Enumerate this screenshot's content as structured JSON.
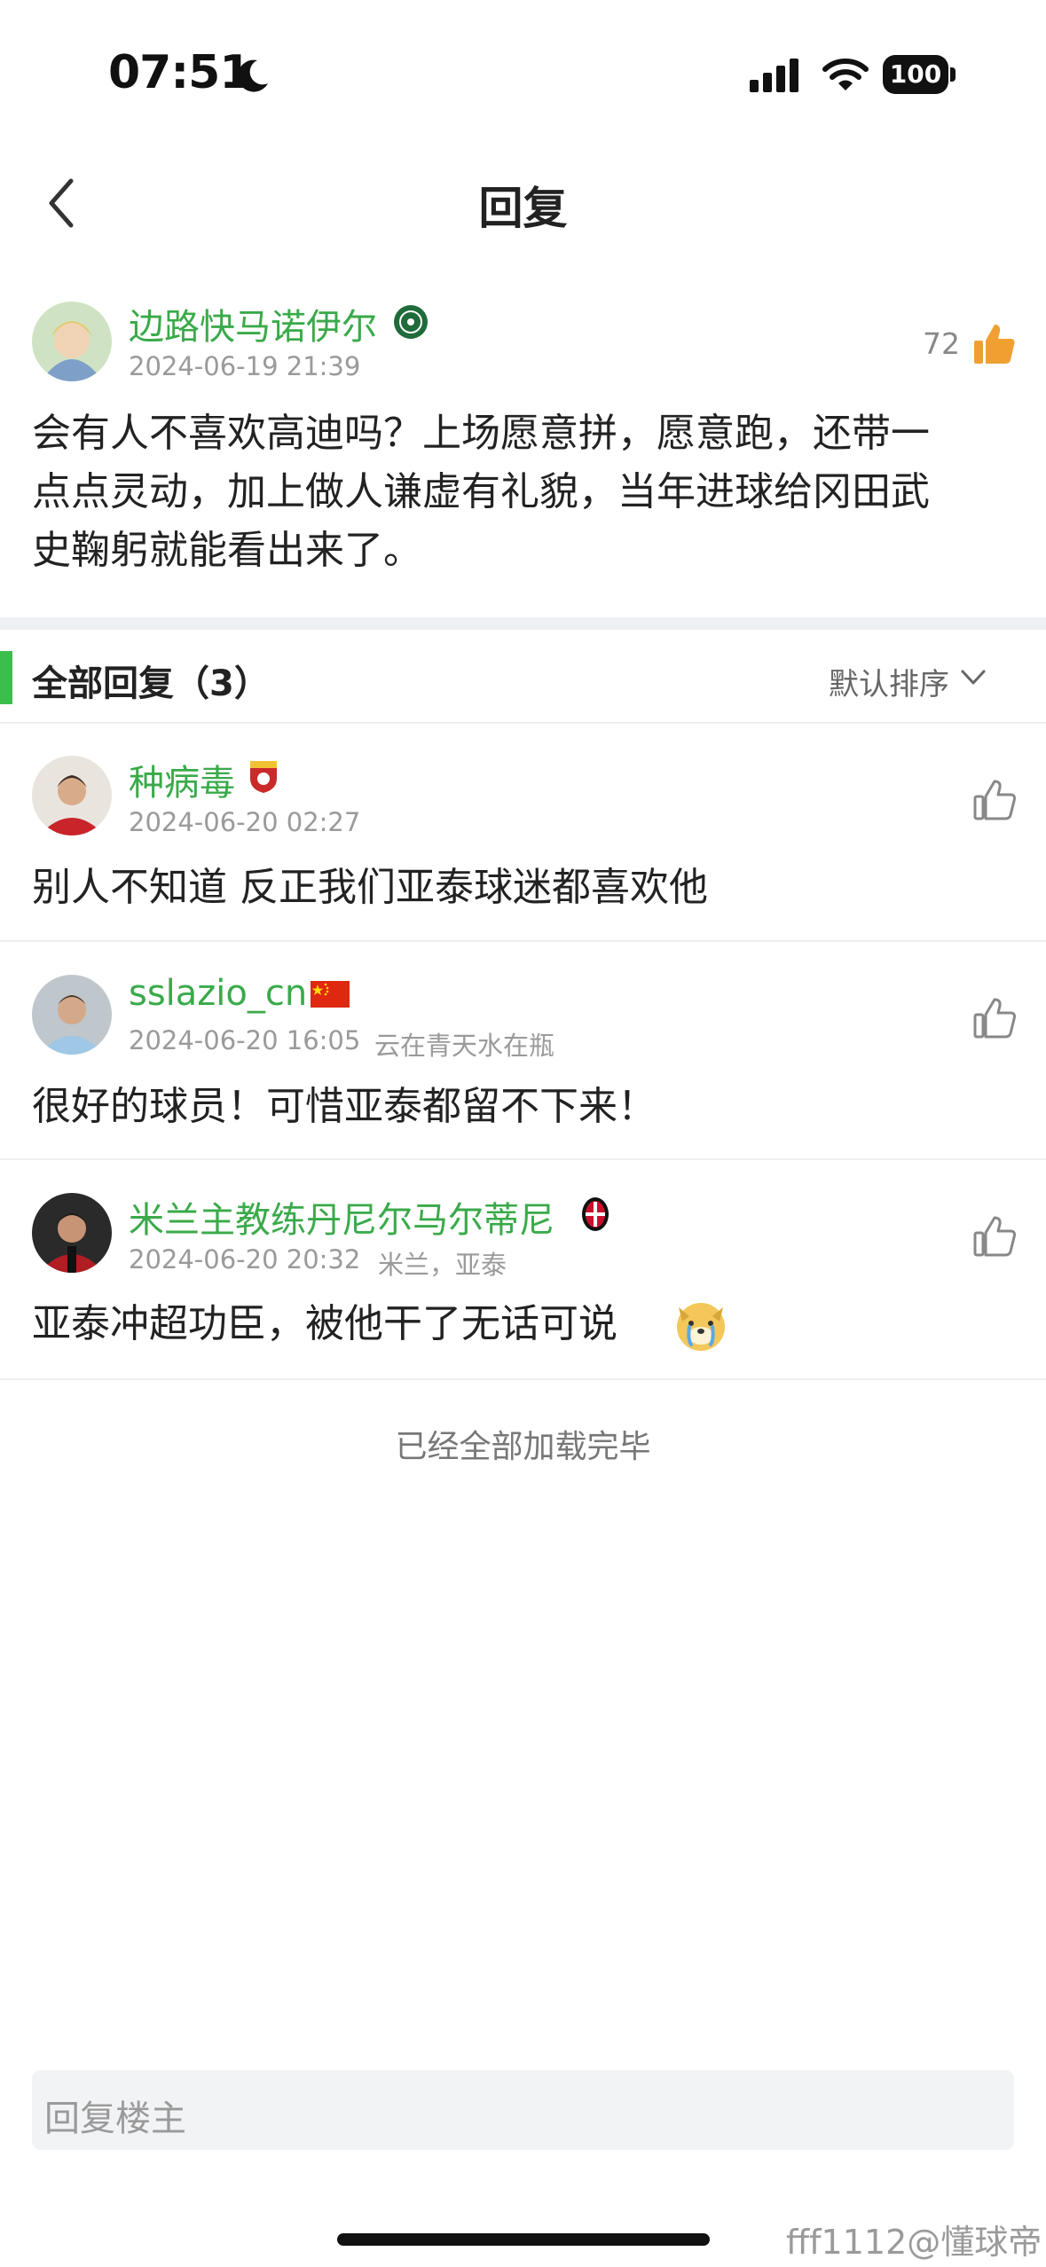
{
  "status_bar": {
    "time": "07:51",
    "battery": "100"
  },
  "header": {
    "title": "回复"
  },
  "main_post": {
    "username": "边路快马诺伊尔",
    "timestamp": "2024-06-19 21:39",
    "like_count": "72",
    "content_line1": "会有人不喜欢高迪吗？上场愿意拼，愿意跑，还带一",
    "content_line2": "点点灵动，加上做人谦虚有礼貌，当年进球给冈田武",
    "content_line3": "史鞠躬就能看出来了。"
  },
  "section": {
    "title": "全部回复（3）",
    "sort_label": "默认排序"
  },
  "replies": [
    {
      "username": "种病毒",
      "timestamp": "2024-06-20 02:27",
      "location": "",
      "content": "别人不知道 反正我们亚泰球迷都喜欢他"
    },
    {
      "username": "sslazio_cn",
      "timestamp": "2024-06-20 16:05",
      "location": "云在青天水在瓶",
      "content": "很好的球员！可惜亚泰都留不下来！"
    },
    {
      "username": "米兰主教练丹尼尔马尔蒂尼",
      "timestamp": "2024-06-20 20:32",
      "location": "米兰，亚泰",
      "content": "亚泰冲超功臣，被他干了无话可说"
    }
  ],
  "footer": {
    "end_text": "已经全部加载完毕",
    "reply_placeholder": "回复楼主"
  },
  "watermark": "fff1112@懂球帝",
  "colors": {
    "accent_green": "#3aaa4a",
    "like_orange": "#f0a030"
  },
  "icons": [
    "moon-icon",
    "signal-icon",
    "wifi-icon",
    "battery-icon",
    "back-chevron-icon",
    "thumbs-up-icon",
    "chevron-down-icon",
    "team-badge-icon",
    "china-flag-icon",
    "ac-milan-badge-icon",
    "crying-dog-emoji"
  ]
}
